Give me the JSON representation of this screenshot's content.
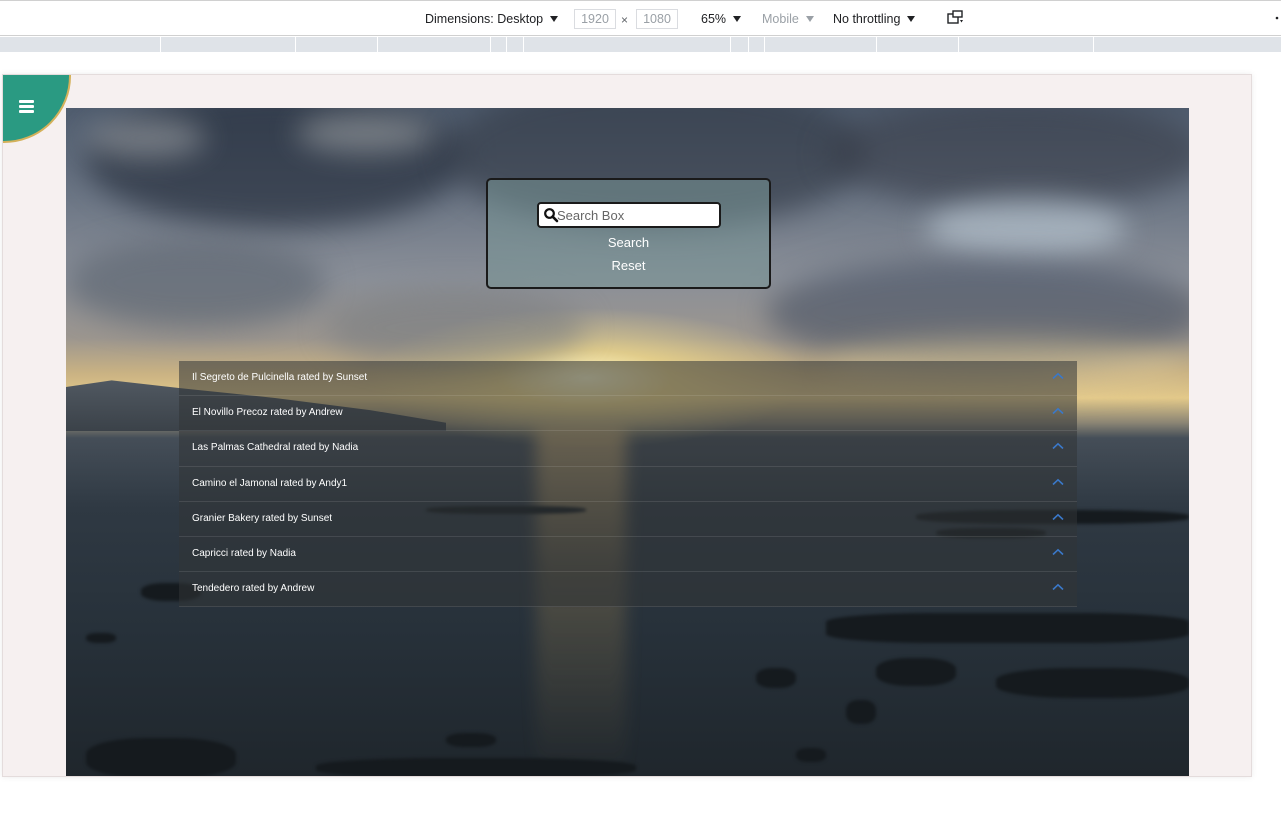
{
  "devtools": {
    "dimensions_label": "Dimensions: Desktop",
    "width_value": "1920",
    "times": "×",
    "height_value": "1080",
    "zoom": "65%",
    "device_mode": "Mobile",
    "throttling": "No throttling"
  },
  "nav": {
    "icon": "hamburger-menu-icon"
  },
  "search": {
    "placeholder": "Search Box",
    "search_label": "Search",
    "reset_label": "Reset",
    "icon": "search-icon"
  },
  "accordion": {
    "items": [
      {
        "label": "Il Segreto de Pulcinella rated by Sunset"
      },
      {
        "label": "El Novillo Precoz rated by Andrew"
      },
      {
        "label": "Las Palmas Cathedral rated by Nadia"
      },
      {
        "label": "Camino el Jamonal rated by Andy1"
      },
      {
        "label": "Granier Bakery rated by Sunset"
      },
      {
        "label": "Capricci rated by Nadia"
      },
      {
        "label": "Tendedero rated by Andrew"
      }
    ],
    "chevron_color": "#3a78c9"
  },
  "colors": {
    "nav_teal": "#2a9a82",
    "nav_border": "#d4b15a",
    "page_bg": "#f6f0f0"
  }
}
